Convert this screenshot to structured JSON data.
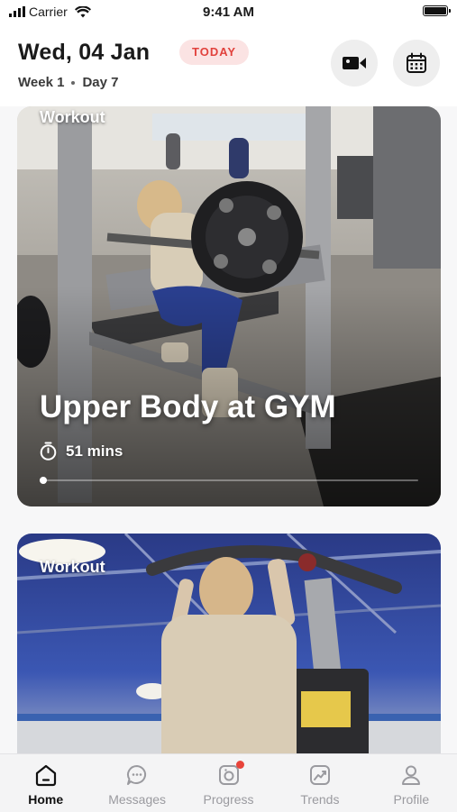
{
  "status_bar": {
    "carrier": "Carrier",
    "time": "9:41 AM"
  },
  "header": {
    "date": "Wed, 04 Jan",
    "today_badge": "TODAY",
    "week": "Week 1",
    "day": "Day 7"
  },
  "cards": [
    {
      "tag": "Workout",
      "title": "Upper Body at GYM",
      "duration": "51 mins",
      "progress_fraction": 0.01
    },
    {
      "tag": "Workout"
    }
  ],
  "tabs": [
    {
      "label": "Home",
      "icon": "home-icon",
      "active": true
    },
    {
      "label": "Messages",
      "icon": "chat-icon"
    },
    {
      "label": "Progress",
      "icon": "camera-icon",
      "notification": true
    },
    {
      "label": "Trends",
      "icon": "trend-icon"
    },
    {
      "label": "Profile",
      "icon": "user-icon"
    }
  ],
  "colors": {
    "accent_red": "#e1423d",
    "badge_bg": "#fbe3e3",
    "notification": "#e8443a"
  }
}
